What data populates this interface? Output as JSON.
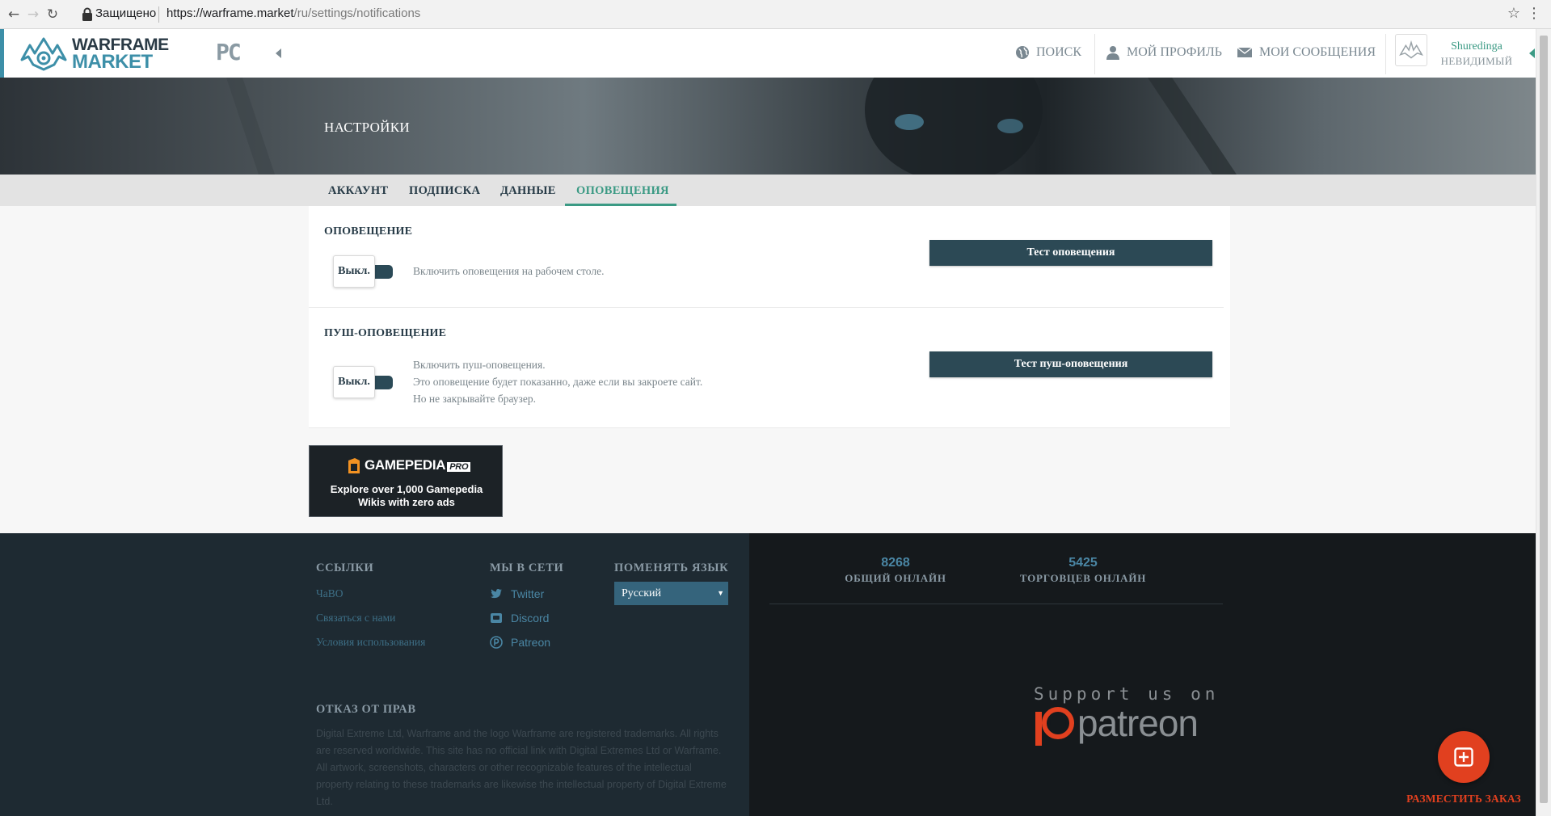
{
  "browser": {
    "secure_label": "Защищено",
    "url_host": "https://warframe.market",
    "url_path": "/ru/settings/notifications"
  },
  "header": {
    "logo_line1": "WARFRAME",
    "logo_line2": "MARKET",
    "platform": "PC",
    "nav": {
      "search": "ПОИСК",
      "profile": "МОЙ ПРОФИЛЬ",
      "messages": "МОИ СООБЩЕНИЯ"
    },
    "user": {
      "name": "Shuredinga",
      "status": "НЕВИДИМЫЙ"
    }
  },
  "banner": {
    "title": "НАСТРОЙКИ"
  },
  "tabs": [
    {
      "label": "АККАУНТ",
      "active": false
    },
    {
      "label": "ПОДПИСКА",
      "active": false
    },
    {
      "label": "ДАННЫЕ",
      "active": false
    },
    {
      "label": "ОПОВЕЩЕНИЯ",
      "active": true
    }
  ],
  "sections": {
    "notification": {
      "title": "ОПОВЕЩЕНИЕ",
      "toggle_label": "Выкл.",
      "enabled": false,
      "description": "Включить оповещения на рабочем столе.",
      "test_button": "Тест оповещения"
    },
    "push": {
      "title": "ПУШ-ОПОВЕЩЕНИЕ",
      "toggle_label": "Выкл.",
      "enabled": false,
      "description_lines": [
        "Включить пуш-оповещения.",
        "Это оповещение будет показанно, даже если вы закроете сайт.",
        "Но не закрывайте браузер."
      ],
      "test_button": "Тест пуш-оповещения"
    }
  },
  "ad": {
    "brand": "GAMEPEDIA",
    "brand_badge": "PRO",
    "line1": "Explore over 1,000 Gamepedia",
    "line2": "Wikis with zero ads"
  },
  "footer": {
    "links": {
      "heading": "ССЫЛКИ",
      "items": [
        "ЧаВО",
        "Связаться с нами",
        "Условия использования"
      ]
    },
    "social": {
      "heading": "МЫ В СЕТИ",
      "items": [
        "Twitter",
        "Discord",
        "Patreon"
      ]
    },
    "language": {
      "heading": "ПОМЕНЯТЬ ЯЗЫК",
      "selected": "Русский"
    },
    "disclaimer": {
      "heading": "ОТКАЗ ОТ ПРАВ",
      "text": "Digital Extreme Ltd, Warframe and the logo Warframe are registered trademarks. All rights are reserved worldwide. This site has no official link with Digital Extremes Ltd or Warframe. All artwork, screenshots, characters or other recognizable features of the intellectual property relating to these trademarks are likewise the intellectual property of Digital Extreme Ltd."
    },
    "stats": [
      {
        "value": "8268",
        "label": "ОБЩИЙ ОНЛАЙН"
      },
      {
        "value": "5425",
        "label": "ТОРГОВЦЕВ ОНЛАЙН"
      }
    ],
    "patreon": {
      "support_text": "Support us on",
      "word": "patreon"
    }
  },
  "fab": {
    "label": "РАЗМЕСТИТЬ ЗАКАЗ"
  },
  "colors": {
    "accent_teal": "#3b9a84",
    "dark_blue": "#2c4955",
    "fab_red": "#e1401f"
  }
}
